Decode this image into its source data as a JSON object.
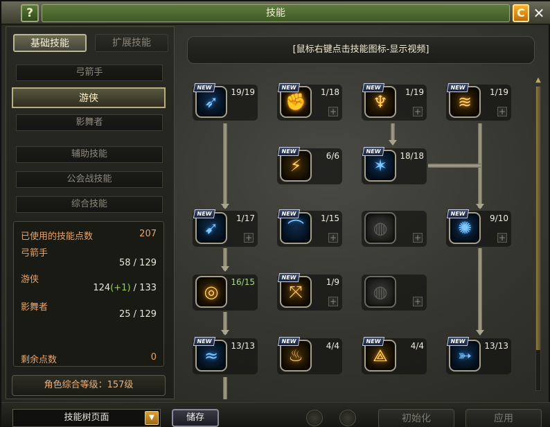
{
  "window": {
    "title": "技能",
    "help_label": "?",
    "reset_icon_label": "C",
    "close_label": "✕"
  },
  "tabs": {
    "basic": "基础技能",
    "extended": "扩展技能"
  },
  "classes": [
    {
      "label": "弓箭手",
      "active": false
    },
    {
      "label": "游侠",
      "active": true
    },
    {
      "label": "影舞者",
      "active": false
    }
  ],
  "categories": [
    "辅助技能",
    "公会战技能",
    "综合技能"
  ],
  "stats": {
    "used_label": "已使用的技能点数",
    "used_value": "207",
    "rows": [
      {
        "label": "弓箭手",
        "value": "58 / 129"
      },
      {
        "label": "游侠",
        "value_main": "124",
        "value_bonus": "(+1)",
        "value_max": " / 133"
      },
      {
        "label": "影舞者",
        "value": "25 / 129"
      }
    ],
    "remaining_label": "剩余点数",
    "remaining_value": "0"
  },
  "level_text": "角色综合等级：157级",
  "hint": "[鼠标右键点击技能图标-显示视频]",
  "skills": [
    {
      "level": "19/19",
      "new": true,
      "style": "blue",
      "icon": "wind-arrow-icon",
      "glyph": "➶",
      "plus": false
    },
    {
      "level": "1/18",
      "new": true,
      "style": "gold",
      "icon": "fist-icon",
      "glyph": "✊",
      "plus": true
    },
    {
      "level": "1/19",
      "new": true,
      "style": "gold",
      "icon": "figure-icon",
      "glyph": "♆",
      "plus": true
    },
    {
      "level": "1/19",
      "new": true,
      "style": "gold",
      "icon": "dash-icon",
      "glyph": "≋",
      "plus": true
    },
    {
      "level": "6/6",
      "new": true,
      "style": "gold",
      "icon": "kick-icon",
      "glyph": "⚡",
      "plus": false
    },
    {
      "level": "18/18",
      "new": true,
      "style": "blue",
      "icon": "burst-icon",
      "glyph": "✶",
      "plus": false
    },
    {
      "level": "1/17",
      "new": true,
      "style": "blue",
      "icon": "multi-arrow-icon",
      "glyph": "➹",
      "plus": true
    },
    {
      "level": "1/15",
      "new": true,
      "style": "blue",
      "icon": "bow-icon",
      "glyph": "⌒",
      "plus": true
    },
    {
      "level": "",
      "new": false,
      "style": "gray",
      "icon": "locked-skill-icon",
      "glyph": "◍",
      "plus": true
    },
    {
      "level": "9/10",
      "new": true,
      "style": "blue",
      "icon": "storm-icon",
      "glyph": "✺",
      "plus": true
    },
    {
      "level": "16/15",
      "new": false,
      "style": "gold",
      "icon": "power-ring-icon",
      "glyph": "◎",
      "plus": false,
      "over": true
    },
    {
      "level": "1/9",
      "new": true,
      "style": "gold",
      "icon": "crossbow-icon",
      "glyph": "⤧",
      "plus": true
    },
    {
      "level": "",
      "new": false,
      "style": "gray",
      "icon": "locked-skill-icon",
      "glyph": "◍",
      "plus": true
    },
    {
      "level": "13/13",
      "new": true,
      "style": "blue",
      "icon": "wave-icon",
      "glyph": "≈",
      "plus": false
    },
    {
      "level": "4/4",
      "new": true,
      "style": "gold",
      "icon": "flame-foot-icon",
      "glyph": "♨",
      "plus": false
    },
    {
      "level": "4/4",
      "new": true,
      "style": "gold",
      "icon": "sigil-icon",
      "glyph": "⟁",
      "plus": false
    },
    {
      "level": "13/13",
      "new": true,
      "style": "blue",
      "icon": "shot-icon",
      "glyph": "➳",
      "plus": false
    }
  ],
  "new_badge": "NEW",
  "bottom": {
    "page_select": "技能树页面",
    "save": "储存",
    "initialize": "初始化",
    "apply": "应用"
  }
}
